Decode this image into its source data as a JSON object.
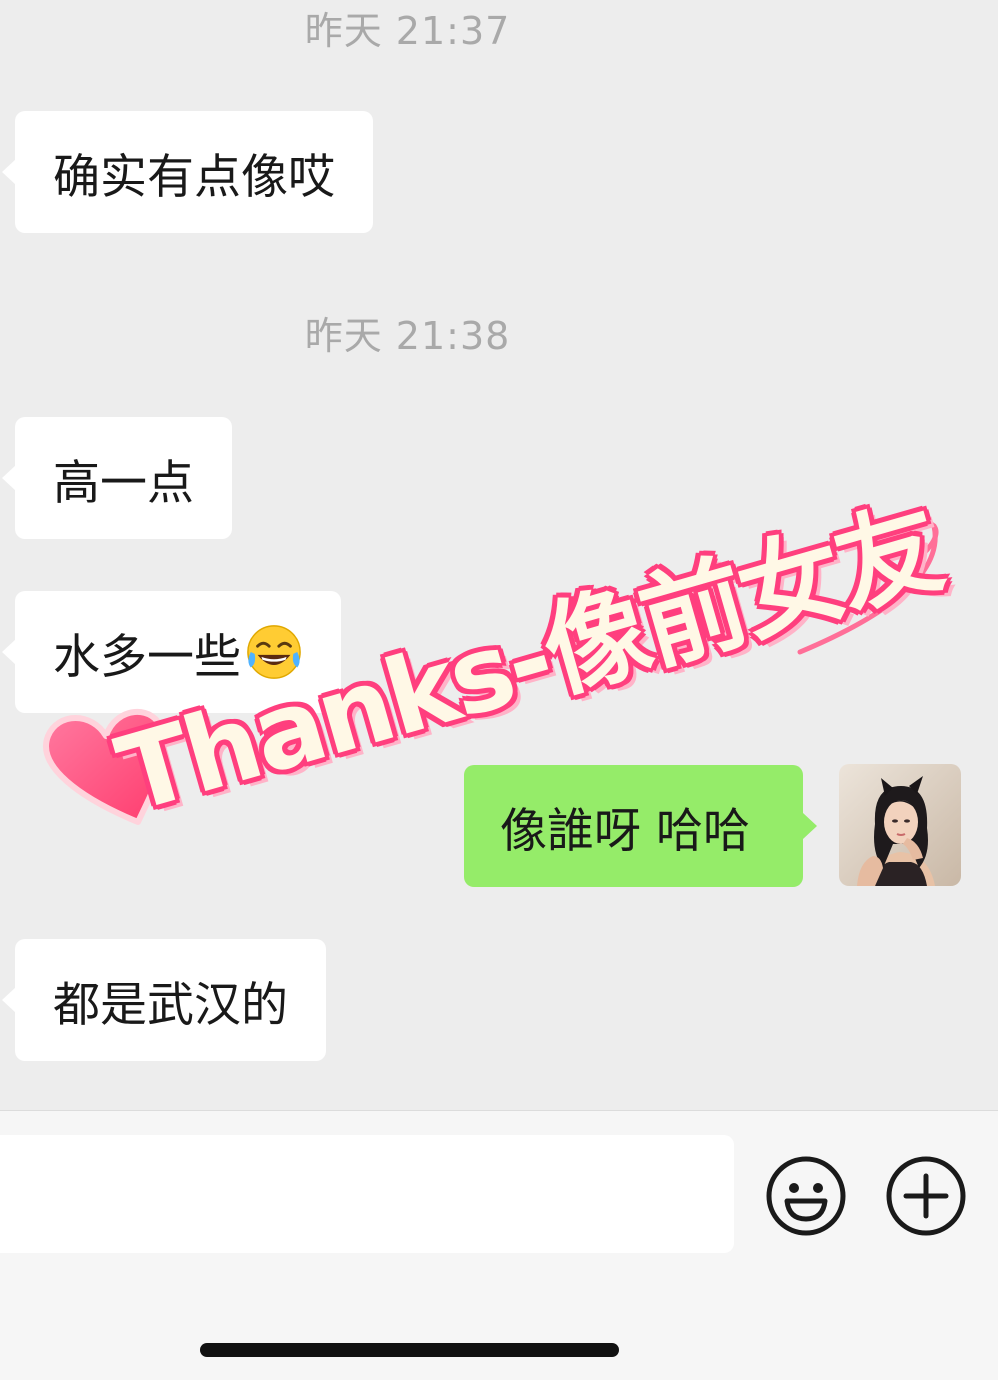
{
  "messages": [
    {
      "type": "timestamp",
      "text": "昨天 21:37"
    },
    {
      "type": "incoming",
      "text": "确实有点像哎"
    },
    {
      "type": "timestamp",
      "text": "昨天 21:38"
    },
    {
      "type": "incoming",
      "text": "高一点"
    },
    {
      "type": "incoming",
      "text": "水多一些",
      "emoji": "tears-of-joy-emoji"
    },
    {
      "type": "outgoing",
      "text": "像誰呀 哈哈"
    },
    {
      "type": "incoming",
      "text": "都是武汉的"
    }
  ],
  "watermark": {
    "text": "Thanks-像前女友"
  },
  "input_bar": {
    "input_value": "",
    "emoji_button_icon": "smiley-face-icon",
    "more_button_icon": "plus-circle-icon"
  },
  "colors": {
    "background": "#ededed",
    "incoming_bubble": "#ffffff",
    "outgoing_bubble": "#95ec69",
    "timestamp": "#a9a9a9",
    "watermark_outline": "#ff3f7e"
  }
}
